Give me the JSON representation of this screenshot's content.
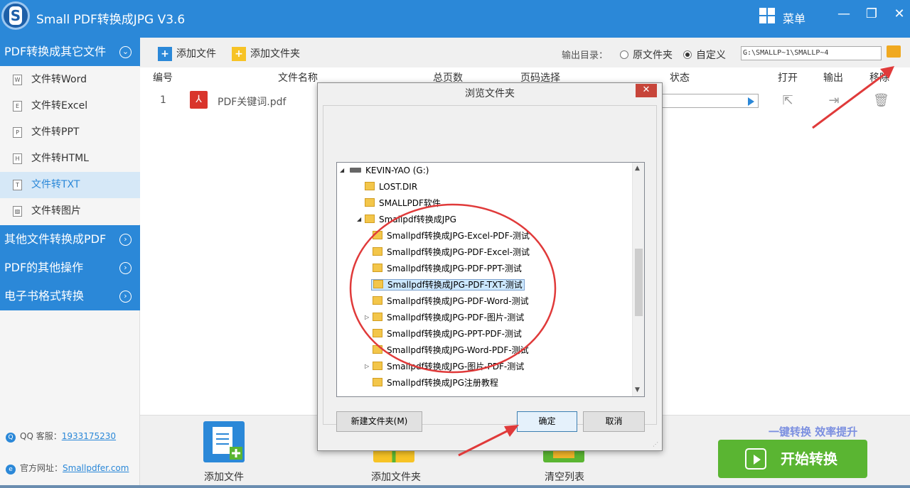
{
  "app": {
    "title": "Small  PDF转换成JPG V3.6",
    "menu_label": "菜单",
    "minimize": "—",
    "restore": "❐",
    "close": "✕",
    "logo_letter": "S"
  },
  "sidebar": {
    "category_main": "PDF转换成其它文件",
    "items": [
      {
        "label": "文件转Word",
        "icon_letter": "W"
      },
      {
        "label": "文件转Excel",
        "icon_letter": "E"
      },
      {
        "label": "文件转PPT",
        "icon_letter": "P"
      },
      {
        "label": "文件转HTML",
        "icon_letter": "H"
      },
      {
        "label": "文件转TXT",
        "icon_letter": "T",
        "active": true
      },
      {
        "label": "文件转图片",
        "icon_letter": "▨"
      }
    ],
    "categories": [
      "其他文件转换成PDF",
      "PDF的其他操作",
      "电子书格式转换"
    ],
    "chevron_down": "⌄",
    "chevron_right": "›",
    "qq_label": "QQ 客服：",
    "qq_number": "1933175230",
    "site_label": "官方网址：",
    "site_url": "Smallpdfer.com"
  },
  "toolbar": {
    "add_file": "添加文件",
    "add_folder": "添加文件夹",
    "output_label": "输出目录：",
    "radio_original": "原文件夹",
    "radio_custom": "自定义",
    "output_path": "G:\\SMALLP~1\\SMALLP~4"
  },
  "table": {
    "headers": [
      "编号",
      "文件名称",
      "总页数",
      "页码选择",
      "状态",
      "打开",
      "输出",
      "移除"
    ],
    "rows": [
      {
        "index": "1",
        "filename": "PDF关键词.pdf"
      }
    ]
  },
  "bottom": {
    "add_file": "添加文件",
    "add_folder": "添加文件夹",
    "clear_list": "清空列表",
    "slogan": "一键转换  效率提升",
    "start": "开始转换"
  },
  "dialog": {
    "title": "浏览文件夹",
    "close": "✕",
    "tree": [
      {
        "label": "KEVIN-YAO (G:)",
        "type": "drive",
        "indent": 0,
        "expanded": true
      },
      {
        "label": "LOST.DIR",
        "type": "folder",
        "indent": 1
      },
      {
        "label": "SMALLPDF软件",
        "type": "folder",
        "indent": 1
      },
      {
        "label": "Smallpdf转换成JPG",
        "type": "folder",
        "indent": 1,
        "expanded": true
      },
      {
        "label": "Smallpdf转换成JPG-Excel-PDF-测试",
        "type": "folder",
        "indent": 2
      },
      {
        "label": "Smallpdf转换成JPG-PDF-Excel-测试",
        "type": "folder",
        "indent": 2
      },
      {
        "label": "Smallpdf转换成JPG-PDF-PPT-测试",
        "type": "folder",
        "indent": 2
      },
      {
        "label": "Smallpdf转换成JPG-PDF-TXT-测试",
        "type": "folder",
        "indent": 2,
        "selected": true
      },
      {
        "label": "Smallpdf转换成JPG-PDF-Word-测试",
        "type": "folder",
        "indent": 2
      },
      {
        "label": "Smallpdf转换成JPG-PDF-图片-测试",
        "type": "folder",
        "indent": 2,
        "collapsed": true
      },
      {
        "label": "Smallpdf转换成JPG-PPT-PDF-测试",
        "type": "folder",
        "indent": 2
      },
      {
        "label": "Smallpdf转换成JPG-Word-PDF-测试",
        "type": "folder",
        "indent": 2
      },
      {
        "label": "Smallpdf转换成JPG-图片-PDF-测试",
        "type": "folder",
        "indent": 2,
        "collapsed": true
      },
      {
        "label": "Smallpdf转换成JPG注册教程",
        "type": "folder",
        "indent": 2
      }
    ],
    "new_folder": "新建文件夹(M)",
    "ok": "确定",
    "cancel": "取消"
  },
  "colors": {
    "accent": "#2b88d8",
    "start_button": "#5ab532",
    "annotation": "#e03a3a"
  }
}
